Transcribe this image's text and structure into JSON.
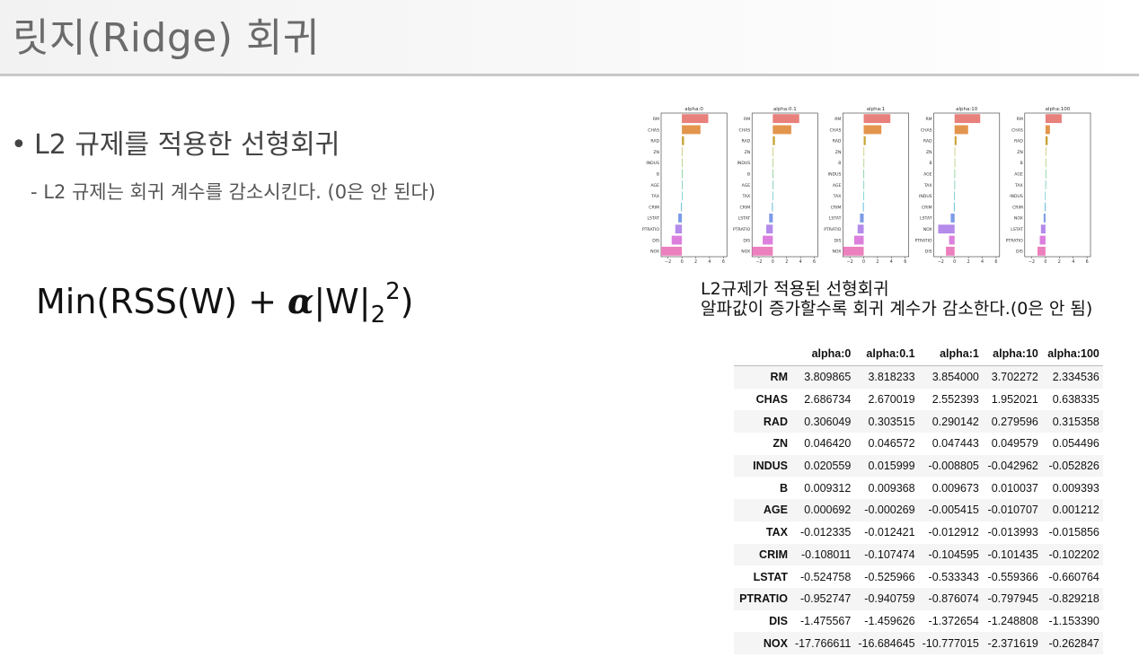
{
  "slide": {
    "title": "릿지(Ridge) 회귀",
    "bullet": "L2 규제를 적용한 선형회귀",
    "sub_bullet": "- L2 규제는 회귀 계수를 감소시킨다. (0은 안 된다)",
    "formula": {
      "prefix": "Min(RSS(W) + ",
      "alpha": "α",
      "norm": "|W|",
      "subscript": "2",
      "superscript": "2",
      "suffix": ")"
    },
    "caption_line1": "L2규제가 적용된 선형회귀",
    "caption_line2": "알파값이 증가할수록 회귀 계수가 감소한다.(0은 안 됨)"
  },
  "chart_data": {
    "type": "bar",
    "orientation": "horizontal",
    "x_ticks": [
      "−2",
      "0",
      "2",
      "4",
      "6"
    ],
    "xlim": [
      -3,
      6.5
    ],
    "panels": [
      {
        "title": "alpha:0",
        "categories": [
          "RM",
          "CHAS",
          "RAD",
          "ZN",
          "INDUS",
          "B",
          "AGE",
          "TAX",
          "CRIM",
          "LSTAT",
          "PTRATIO",
          "DIS",
          "NOX"
        ],
        "values": [
          3.809865,
          2.686734,
          0.306049,
          0.04642,
          0.020559,
          0.009312,
          0.000692,
          -0.012335,
          -0.108011,
          -0.524758,
          -0.952747,
          -1.475567,
          -17.766611
        ]
      },
      {
        "title": "alpha:0.1",
        "categories": [
          "RM",
          "CHAS",
          "RAD",
          "ZN",
          "INDUS",
          "B",
          "AGE",
          "TAX",
          "CRIM",
          "LSTAT",
          "PTRATIO",
          "DIS",
          "NOX"
        ],
        "values": [
          3.818233,
          2.670019,
          0.303515,
          0.046572,
          0.015999,
          0.009368,
          -0.000269,
          -0.012421,
          -0.107474,
          -0.525966,
          -0.940759,
          -1.459626,
          -16.684645
        ]
      },
      {
        "title": "alpha:1",
        "categories": [
          "RM",
          "CHAS",
          "RAD",
          "ZN",
          "B",
          "INDUS",
          "AGE",
          "TAX",
          "CRIM",
          "LSTAT",
          "PTRATIO",
          "DIS",
          "NOX"
        ],
        "values": [
          3.854,
          2.552393,
          0.290142,
          0.047443,
          0.009673,
          -0.008805,
          -0.005415,
          -0.012912,
          -0.104595,
          -0.533343,
          -0.876074,
          -1.372654,
          -10.777015
        ]
      },
      {
        "title": "alpha:10",
        "categories": [
          "RM",
          "CHAS",
          "RAD",
          "ZN",
          "B",
          "AGE",
          "TAX",
          "INDUS",
          "CRIM",
          "LSTAT",
          "NOX",
          "PTRATIO",
          "DIS"
        ],
        "values": [
          3.702272,
          1.952021,
          0.279596,
          0.049579,
          0.010037,
          -0.010707,
          -0.013993,
          -0.042962,
          -0.101435,
          -0.559366,
          -2.371619,
          -0.797945,
          -1.248808
        ]
      },
      {
        "title": "alpha:100",
        "categories": [
          "RM",
          "CHAS",
          "RAD",
          "ZN",
          "B",
          "AGE",
          "TAX",
          "INDUS",
          "CRIM",
          "NOX",
          "LSTAT",
          "PTRATIO",
          "DIS"
        ],
        "values": [
          2.334536,
          0.638335,
          0.315358,
          0.054496,
          0.009393,
          0.001212,
          -0.015856,
          -0.052826,
          -0.102202,
          -0.262847,
          -0.660764,
          -0.829218,
          -1.15339
        ]
      }
    ],
    "bar_colors": [
      "#e8807c",
      "#e3954d",
      "#c9a336",
      "#b2b13f",
      "#8fba47",
      "#4fb968",
      "#42b898",
      "#3fb7b8",
      "#42acd4",
      "#7b9be6",
      "#b48aea",
      "#dc7fdd",
      "#ec7fbd"
    ]
  },
  "table": {
    "columns": [
      "alpha:0",
      "alpha:0.1",
      "alpha:1",
      "alpha:10",
      "alpha:100"
    ],
    "rows": [
      {
        "label": "RM",
        "values": [
          "3.809865",
          "3.818233",
          "3.854000",
          "3.702272",
          "2.334536"
        ]
      },
      {
        "label": "CHAS",
        "values": [
          "2.686734",
          "2.670019",
          "2.552393",
          "1.952021",
          "0.638335"
        ]
      },
      {
        "label": "RAD",
        "values": [
          "0.306049",
          "0.303515",
          "0.290142",
          "0.279596",
          "0.315358"
        ]
      },
      {
        "label": "ZN",
        "values": [
          "0.046420",
          "0.046572",
          "0.047443",
          "0.049579",
          "0.054496"
        ]
      },
      {
        "label": "INDUS",
        "values": [
          "0.020559",
          "0.015999",
          "-0.008805",
          "-0.042962",
          "-0.052826"
        ]
      },
      {
        "label": "B",
        "values": [
          "0.009312",
          "0.009368",
          "0.009673",
          "0.010037",
          "0.009393"
        ]
      },
      {
        "label": "AGE",
        "values": [
          "0.000692",
          "-0.000269",
          "-0.005415",
          "-0.010707",
          "0.001212"
        ]
      },
      {
        "label": "TAX",
        "values": [
          "-0.012335",
          "-0.012421",
          "-0.012912",
          "-0.013993",
          "-0.015856"
        ]
      },
      {
        "label": "CRIM",
        "values": [
          "-0.108011",
          "-0.107474",
          "-0.104595",
          "-0.101435",
          "-0.102202"
        ]
      },
      {
        "label": "LSTAT",
        "values": [
          "-0.524758",
          "-0.525966",
          "-0.533343",
          "-0.559366",
          "-0.660764"
        ]
      },
      {
        "label": "PTRATIO",
        "values": [
          "-0.952747",
          "-0.940759",
          "-0.876074",
          "-0.797945",
          "-0.829218"
        ]
      },
      {
        "label": "DIS",
        "values": [
          "-1.475567",
          "-1.459626",
          "-1.372654",
          "-1.248808",
          "-1.153390"
        ]
      },
      {
        "label": "NOX",
        "values": [
          "-17.766611",
          "-16.684645",
          "-10.777015",
          "-2.371619",
          "-0.262847"
        ]
      }
    ]
  }
}
